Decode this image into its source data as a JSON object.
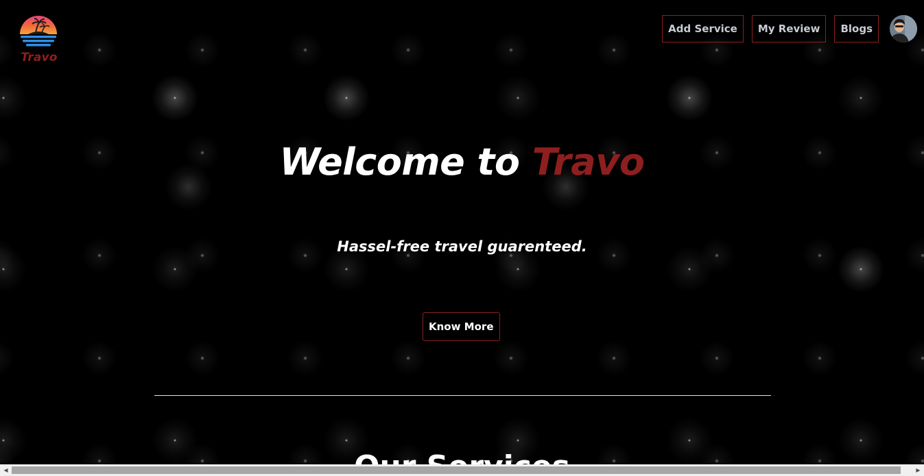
{
  "logo": {
    "text": "Travo",
    "icon": "sunset-palm-island-icon"
  },
  "nav": {
    "items": [
      {
        "label": "Add Service"
      },
      {
        "label": "My Review"
      },
      {
        "label": "Blogs"
      }
    ],
    "avatar": "user-avatar"
  },
  "hero": {
    "title_prefix": "Welcome to ",
    "title_brand": "Travo",
    "subtitle": "Hassel-free travel guarenteed.",
    "cta_label": "Know More"
  },
  "section": {
    "title": "Our Services"
  },
  "scrollbar": {
    "left_arrow": "◀",
    "right_arrow": "▶"
  },
  "colors": {
    "background": "#000000",
    "accent": "#8e1f1f",
    "nav_text": "#c8ccd2",
    "text": "#ffffff"
  }
}
